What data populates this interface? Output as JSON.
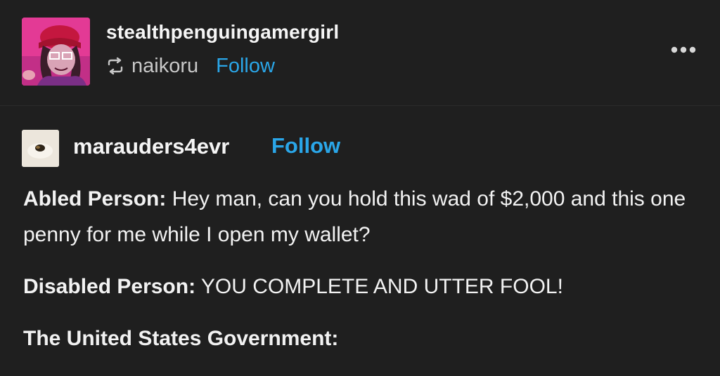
{
  "post": {
    "blog_name": "stealthpenguingamergirl",
    "reblog_source": "naikoru",
    "follow_label": "Follow",
    "more_icon": "more-horizontal-icon",
    "reblog_icon": "reblog-icon"
  },
  "trail": {
    "name": "marauders4evr",
    "follow_label": "Follow"
  },
  "content": {
    "lines": [
      {
        "speaker": "Abled Person:",
        "text": " Hey man, can you hold this wad of $2,000 and this one penny for me while I open my wallet?"
      },
      {
        "speaker": "Disabled Person:",
        "text": " YOU COMPLETE AND UTTER FOOL!"
      },
      {
        "speaker": "The United States Government:",
        "text": ""
      }
    ]
  },
  "colors": {
    "background": "#1f1f1f",
    "follow": "#2aa6e8",
    "avatar_bg": "#e9389a"
  }
}
